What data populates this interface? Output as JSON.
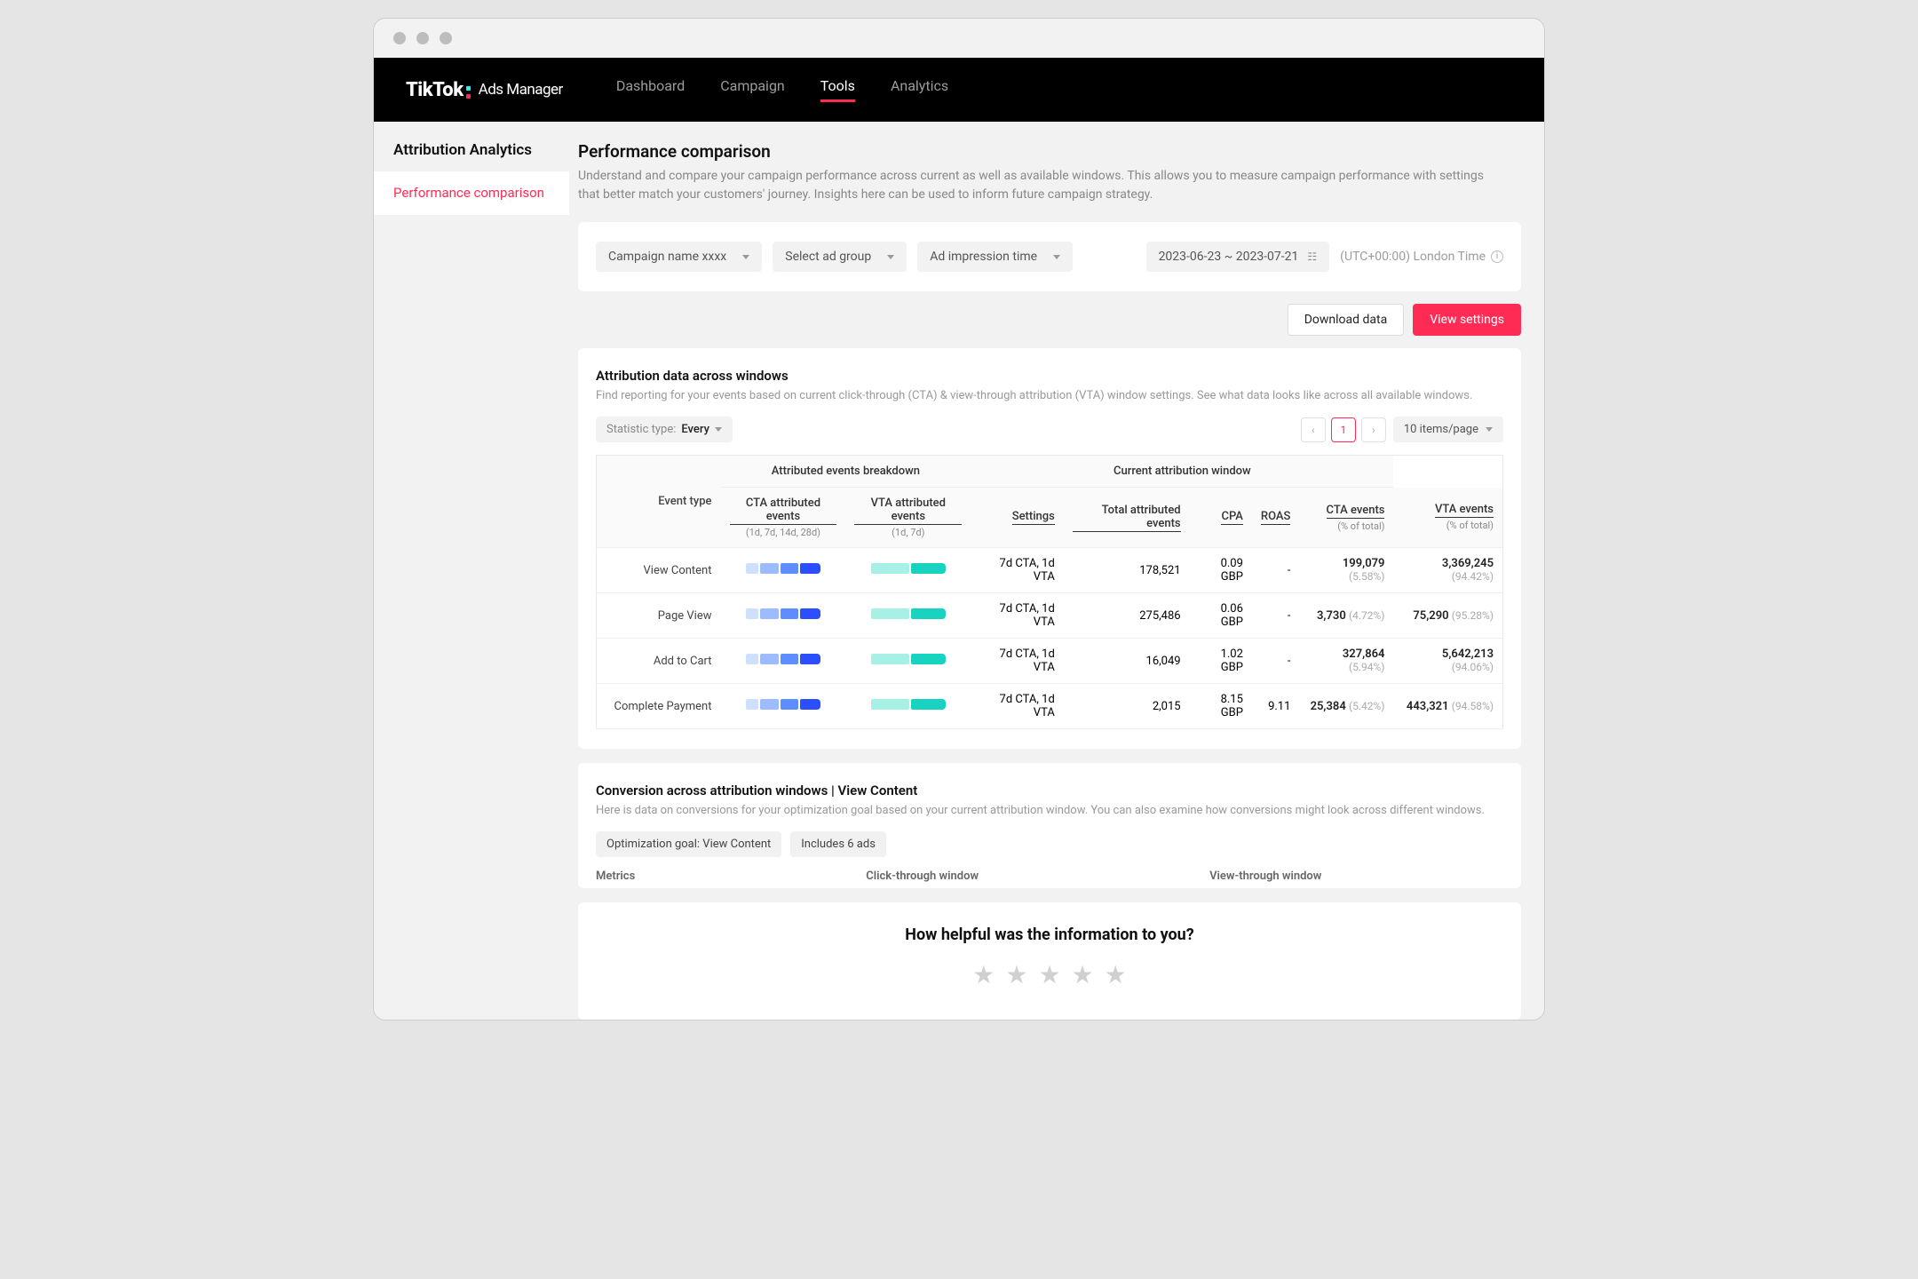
{
  "brand": {
    "name": "TikTok",
    "product": "Ads Manager"
  },
  "nav": {
    "dashboard": "Dashboard",
    "campaign": "Campaign",
    "tools": "Tools",
    "analytics": "Analytics"
  },
  "sidebar": {
    "title": "Attribution Analytics",
    "item": "Performance comparison"
  },
  "page": {
    "title": "Performance comparison",
    "desc": "Understand and compare your campaign performance across current as well as available windows. This allows you to measure campaign performance with settings that better match your customers' journey. Insights here can be used to inform future campaign strategy."
  },
  "filters": {
    "campaign": "Campaign name xxxx",
    "adgroup": "Select ad group",
    "adtime": "Ad impression time",
    "daterange": "2023-06-23 ~ 2023-07-21",
    "timezone": "(UTC+00:00) London Time"
  },
  "actions": {
    "download": "Download data",
    "viewsettings": "View settings"
  },
  "attribution": {
    "title": "Attribution data across windows",
    "desc": "Find reporting for your events based on current click-through (CTA) & view-through attribution (VTA) window settings. See what data looks like across all available windows.",
    "stat_label": "Statistic type:",
    "stat_value": "Every",
    "page": "1",
    "itemspp": "10 items/page",
    "headers": {
      "event": "Event type",
      "breakdown": "Attributed events breakdown",
      "current": "Current attribution window",
      "cta": "CTA attributed events",
      "cta_sub": "(1d, 7d, 14d, 28d)",
      "vta": "VTA attributed events",
      "vta_sub": "(1d, 7d)",
      "settings": "Settings",
      "total": "Total attributed events",
      "cpa": "CPA",
      "roas": "ROAS",
      "cta_events": "CTA events",
      "vta_events": "VTA events",
      "pct": "(% of total)"
    },
    "rows": [
      {
        "event": "View Content",
        "settings": "7d CTA, 1d VTA",
        "total": "178,521",
        "cpa": "0.09 GBP",
        "roas": "-",
        "cta": "199,079",
        "cta_pct": "(5.58%)",
        "vta": "3,369,245",
        "vta_pct": "(94.42%)"
      },
      {
        "event": "Page View",
        "settings": "7d CTA, 1d VTA",
        "total": "275,486",
        "cpa": "0.06 GBP",
        "roas": "-",
        "cta": "3,730",
        "cta_pct": "(4.72%)",
        "vta": "75,290",
        "vta_pct": "(95.28%)"
      },
      {
        "event": "Add to Cart",
        "settings": "7d CTA, 1d VTA",
        "total": "16,049",
        "cpa": "1.02 GBP",
        "roas": "-",
        "cta": "327,864",
        "cta_pct": "(5.94%)",
        "vta": "5,642,213",
        "vta_pct": "(94.06%)"
      },
      {
        "event": "Complete Payment",
        "settings": "7d CTA, 1d VTA",
        "total": "2,015",
        "cpa": "8.15 GBP",
        "roas": "9.11",
        "cta": "25,384",
        "cta_pct": "(5.42%)",
        "vta": "443,321",
        "vta_pct": "(94.58%)"
      }
    ]
  },
  "conversion": {
    "title": "Conversion across attribution windows | View Content",
    "desc": "Here is data on conversions for your optimization goal based on your current attribution window. You can also examine how conversions might look across different windows.",
    "badge1": "Optimization goal: View Content",
    "badge2": "Includes 6 ads",
    "col_metrics": "Metrics",
    "col_click": "Click-through window",
    "col_view": "View-through window"
  },
  "feedback": {
    "title": "How helpful was the information to you?"
  }
}
